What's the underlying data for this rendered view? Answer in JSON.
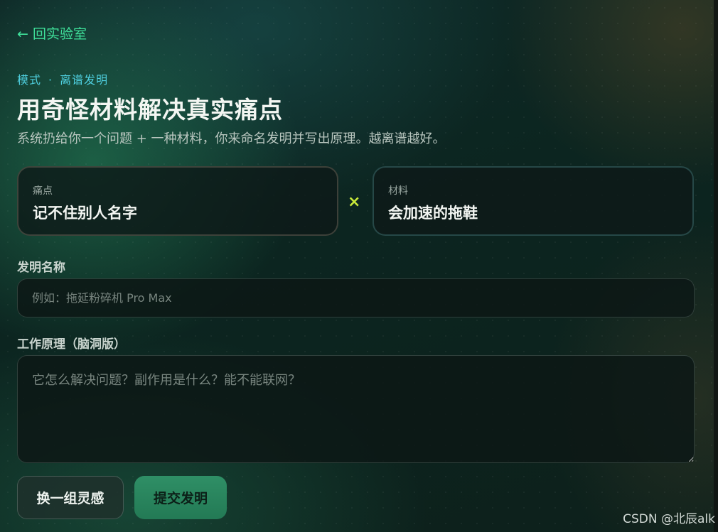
{
  "nav": {
    "back_label": "← 回实验室"
  },
  "header": {
    "mode_prefix": "模式",
    "mode_separator": "·",
    "mode_name": "离谱发明",
    "title": "用奇怪材料解决真实痛点",
    "subtitle": "系统扔给你一个问题 + 一种材料，你来命名发明并写出原理。越离谱越好。"
  },
  "prompt": {
    "pain_label": "痛点",
    "pain_value": "记不住别人名字",
    "operator": "×",
    "material_label": "材料",
    "material_value": "会加速的拖鞋"
  },
  "form": {
    "name_label": "发明名称",
    "name_value": "",
    "name_placeholder": "例如：拖延粉碎机 Pro Max",
    "principle_label": "工作原理（脑洞版）",
    "principle_value": "",
    "principle_placeholder": "它怎么解决问题？副作用是什么？能不能联网？"
  },
  "actions": {
    "shuffle_label": "换一组灵感",
    "submit_label": "提交发明"
  },
  "watermark": "CSDN @北辰alk",
  "colors": {
    "accent_green": "#3fe09a",
    "accent_cyan": "#4fd0e0",
    "operator_yellow": "#c7e83a",
    "submit_bg": "#2f8f66"
  }
}
